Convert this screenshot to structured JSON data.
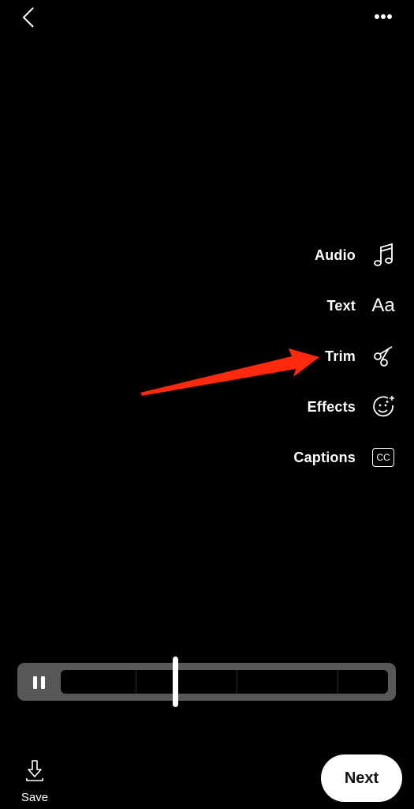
{
  "top_bar": {
    "back_icon": "chevron-left-icon",
    "more_icon": "more-horizontal-icon"
  },
  "tools": [
    {
      "label": "Audio",
      "icon": "music-note-icon"
    },
    {
      "label": "Text",
      "icon": "text-aa-icon",
      "glyph": "Aa"
    },
    {
      "label": "Trim",
      "icon": "scissors-icon"
    },
    {
      "label": "Effects",
      "icon": "face-sparkle-icon"
    },
    {
      "label": "Captions",
      "icon": "closed-captions-icon",
      "glyph": "CC"
    }
  ],
  "annotation": {
    "type": "arrow",
    "color": "#ff2a0d",
    "points_to": "Trim"
  },
  "timeline": {
    "state": "playing",
    "playhead_fraction": 0.35,
    "frame_count": 5
  },
  "bottom_bar": {
    "save_label": "Save",
    "save_icon": "download-icon",
    "next_label": "Next"
  },
  "colors": {
    "background": "#000000",
    "timeline_track": "#585858",
    "next_button_bg": "#ffffff"
  }
}
